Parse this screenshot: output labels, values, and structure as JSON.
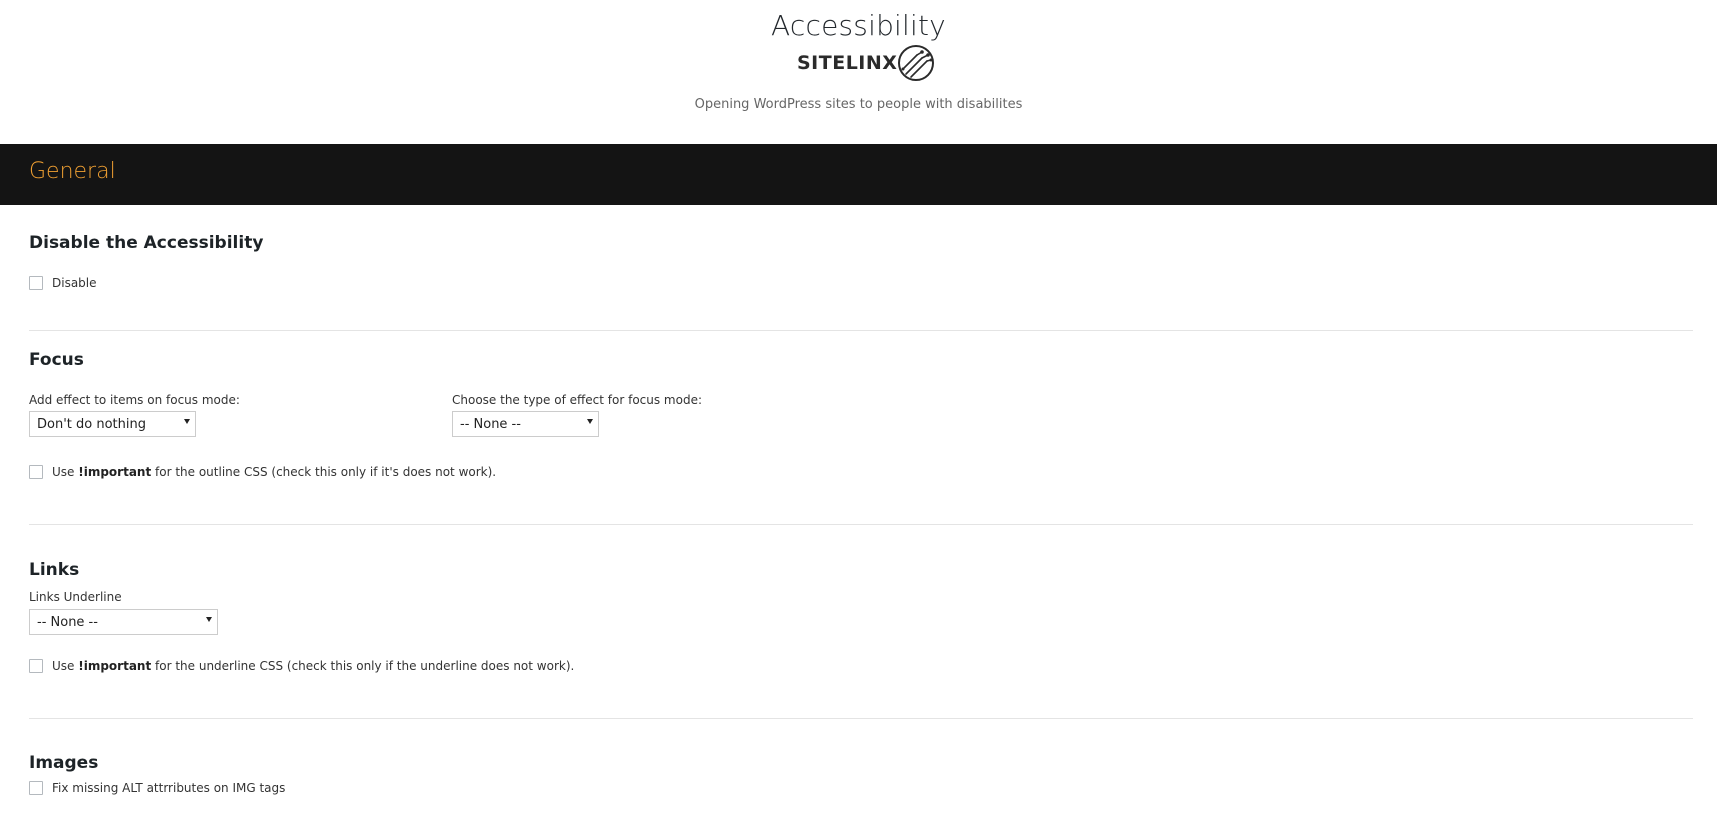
{
  "header": {
    "title": "Accessibility",
    "logo_text": "SITELINX",
    "tagline": "Opening WordPress sites to people with disabilites"
  },
  "section": {
    "title": "General"
  },
  "disable_group": {
    "title": "Disable the Accessibility",
    "checkbox_label": "Disable",
    "checked": false
  },
  "focus_group": {
    "title": "Focus",
    "effect_label": "Add effect to items on focus mode:",
    "effect_value": "Don't do nothing",
    "type_label": "Choose the type of effect for focus mode:",
    "type_value": "-- None --",
    "important_prefix": "Use ",
    "important_bold": "!important",
    "important_suffix": " for the outline CSS (check this only if it's does not work).",
    "important_checked": false
  },
  "links_group": {
    "title": "Links",
    "underline_label": "Links Underline",
    "underline_value": "-- None --",
    "important_prefix": "Use ",
    "important_bold": "!important",
    "important_suffix": " for the underline CSS (check this only if the underline does not work).",
    "important_checked": false
  },
  "images_group": {
    "title": "Images",
    "checkbox_label": "Fix missing ALT attrributes on IMG tags",
    "checked": false
  },
  "colors": {
    "section_bar_bg": "#141414",
    "section_title": "#f0a032"
  },
  "icons": {
    "logo_mark": "circuit-globe-icon",
    "select_caret": "caret-down-icon"
  }
}
